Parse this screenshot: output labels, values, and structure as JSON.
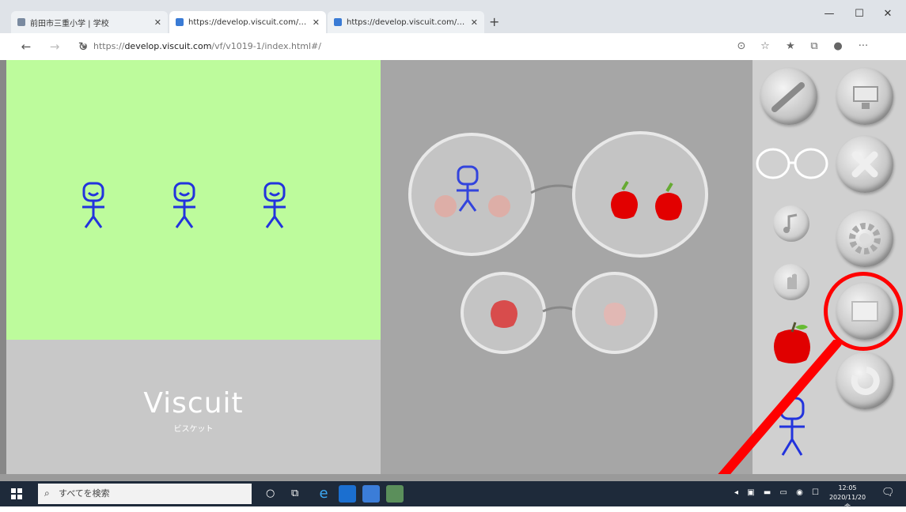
{
  "browser": {
    "tabs": [
      {
        "title": "前田市三重小学 | 学校",
        "active": false
      },
      {
        "title": "https://develop.viscuit.com/vf/",
        "active": true
      },
      {
        "title": "https://develop.viscuit.com/vf/",
        "active": false
      }
    ],
    "new_tab_label": "+",
    "url_prefix": "https://",
    "url_host": "develop.viscuit.com",
    "url_path": "/vf/v1019-1/index.html#/"
  },
  "app": {
    "title": "Viscuit",
    "subtitle": "ビスケット",
    "highlight_color": "#ff0000",
    "stage_color": "#bdfb9c"
  },
  "taskbar": {
    "search_placeholder": "すべてを検索",
    "time": "12:05",
    "date": "2020/11/20 金"
  },
  "icons": {
    "pencil": "pencil-icon",
    "monitor": "monitor-icon",
    "close": "close-icon",
    "gear": "gear-icon",
    "music": "music-icon",
    "hand": "hand-icon",
    "fullscreen": "fullscreen-icon",
    "undo": "undo-icon"
  }
}
